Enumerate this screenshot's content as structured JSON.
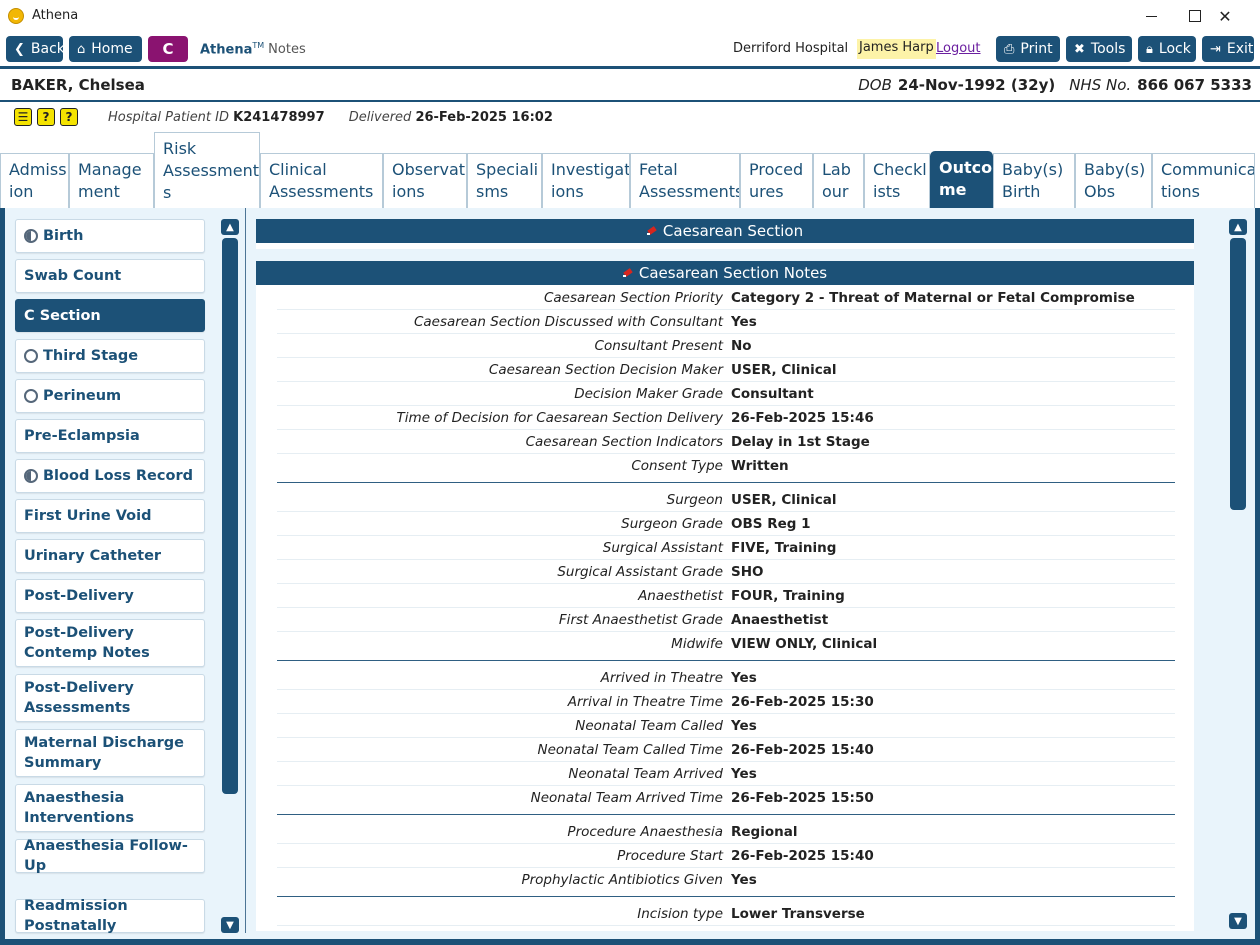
{
  "window": {
    "title": "Athena"
  },
  "nav": {
    "back": "Back",
    "home": "Home",
    "c_badge": "C",
    "brand": "Athena",
    "brand_tm": "TM",
    "brand_sub": "Notes",
    "hospital": "Derriford Hospital",
    "user": "James Harp",
    "logout": "Logout",
    "print": "Print",
    "tools": "Tools",
    "lock": "Lock",
    "exit": "Exit"
  },
  "patient": {
    "name": "BAKER, Chelsea",
    "dob_label": "DOB",
    "dob": "24-Nov-1992 (32y)",
    "nhs_label": "NHS No.",
    "nhs": "866 067 5333",
    "hospital_id_label": "Hospital Patient ID",
    "hospital_id": "K241478997",
    "delivered_label": "Delivered",
    "delivered": "26-Feb-2025 16:02"
  },
  "tabs": [
    {
      "label": "Admiss\nion"
    },
    {
      "label": "Manage\nment"
    },
    {
      "label": "Risk\nAssessment\ns"
    },
    {
      "label": "Clinical\nAssessments"
    },
    {
      "label": "Observat\nions"
    },
    {
      "label": "Speciali\nsms"
    },
    {
      "label": "Investigat\nions"
    },
    {
      "label": "Fetal\nAssessments"
    },
    {
      "label": "Proced\nures"
    },
    {
      "label": "Lab\nour"
    },
    {
      "label": "Checkl\nists"
    },
    {
      "label": "Outco\nme"
    },
    {
      "label": "Baby(s)\nBirth"
    },
    {
      "label": "Baby(s)\nObs"
    },
    {
      "label": "Communica\ntions"
    }
  ],
  "sidebar": [
    {
      "label": "Birth"
    },
    {
      "label": "Swab Count"
    },
    {
      "label": "C Section"
    },
    {
      "label": "Third Stage"
    },
    {
      "label": "Perineum"
    },
    {
      "label": "Pre-Eclampsia"
    },
    {
      "label": "Blood Loss Record"
    },
    {
      "label": "First Urine Void"
    },
    {
      "label": "Urinary Catheter"
    },
    {
      "label": "Post-Delivery"
    },
    {
      "label": "Post-Delivery Contemp Notes"
    },
    {
      "label": "Post-Delivery Assessments"
    },
    {
      "label": "Maternal Discharge Summary"
    },
    {
      "label": "Anaesthesia Interventions"
    },
    {
      "label": "Anaesthesia Follow-Up"
    },
    {
      "label": "Readmission Postnatally"
    }
  ],
  "section": {
    "title": "Caesarean Section"
  },
  "notes": {
    "title": "Caesarean Section Notes",
    "rows": [
      {
        "label": "Caesarean Section Priority",
        "value": "Category 2 - Threat of Maternal or Fetal Compromise"
      },
      {
        "label": "Caesarean Section Discussed with Consultant",
        "value": "Yes"
      },
      {
        "label": "Consultant Present",
        "value": "No"
      },
      {
        "label": "Caesarean Section Decision Maker",
        "value": "USER, Clinical"
      },
      {
        "label": "Decision Maker Grade",
        "value": "Consultant"
      },
      {
        "label": "Time of Decision for Caesarean Section Delivery",
        "value": "26-Feb-2025 15:46"
      },
      {
        "label": "Caesarean Section Indicators",
        "value": "Delay in 1st Stage"
      },
      {
        "label": "Consent Type",
        "value": "Written"
      },
      {
        "label": "Surgeon",
        "value": "USER, Clinical"
      },
      {
        "label": "Surgeon Grade",
        "value": "OBS Reg 1"
      },
      {
        "label": "Surgical Assistant",
        "value": "FIVE, Training"
      },
      {
        "label": "Surgical Assistant Grade",
        "value": "SHO"
      },
      {
        "label": "Anaesthetist",
        "value": "FOUR, Training"
      },
      {
        "label": "First Anaesthetist Grade",
        "value": "Anaesthetist"
      },
      {
        "label": "Midwife",
        "value": "VIEW ONLY, Clinical"
      },
      {
        "label": "Arrived in Theatre",
        "value": "Yes"
      },
      {
        "label": "Arrival in Theatre Time",
        "value": "26-Feb-2025 15:30"
      },
      {
        "label": "Neonatal Team Called",
        "value": "Yes"
      },
      {
        "label": "Neonatal Team Called Time",
        "value": "26-Feb-2025 15:40"
      },
      {
        "label": "Neonatal Team Arrived",
        "value": "Yes"
      },
      {
        "label": "Neonatal Team Arrived Time",
        "value": "26-Feb-2025 15:50"
      },
      {
        "label": "Procedure Anaesthesia",
        "value": "Regional"
      },
      {
        "label": "Procedure Start",
        "value": "26-Feb-2025 15:40"
      },
      {
        "label": "Prophylactic Antibiotics Given",
        "value": "Yes"
      },
      {
        "label": "Incision type",
        "value": "Lower Transverse"
      }
    ]
  },
  "colors": {
    "primary": "#1c5177",
    "accent_c": "#8a1370",
    "background": "#e9f4fb",
    "user_highlight": "#fdf3a8"
  }
}
